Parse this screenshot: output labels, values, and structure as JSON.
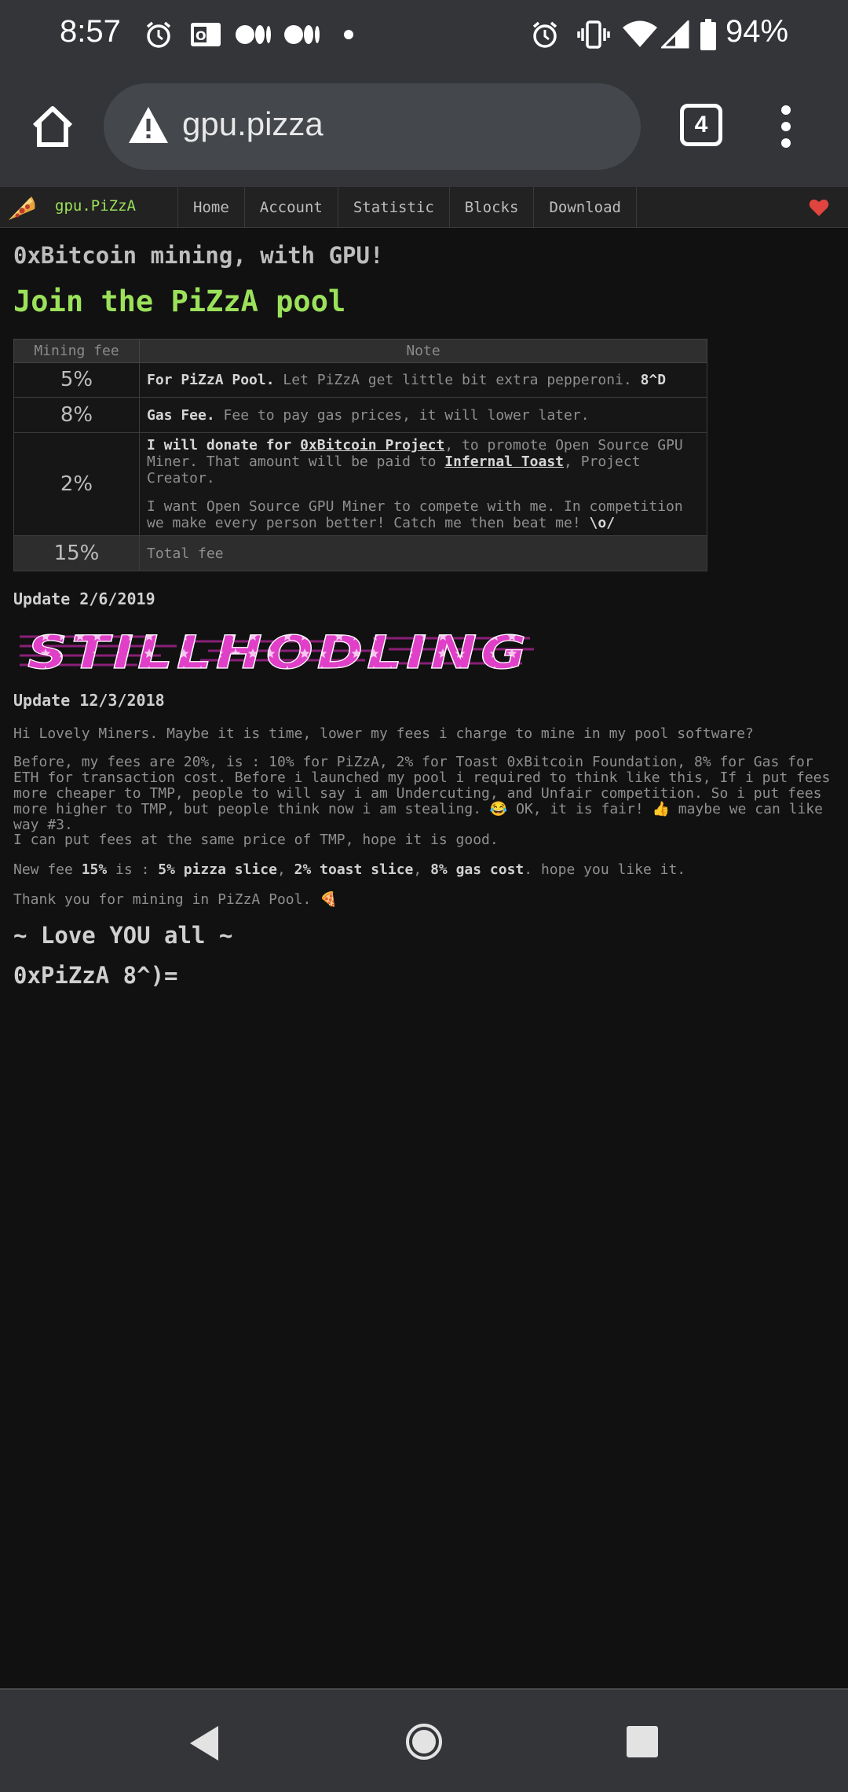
{
  "status_bar": {
    "time": "8:57",
    "battery_pct": "94%",
    "left_icons": [
      "alarm-icon",
      "email-icon",
      "medium-icon",
      "medium-icon",
      "dot-icon"
    ],
    "right_icons": [
      "alarm-icon",
      "vibrate-icon",
      "wifi-icon",
      "signal-icon",
      "battery-icon"
    ]
  },
  "browser": {
    "url": "gpu.pizza",
    "tab_count": "4"
  },
  "site_nav": {
    "brand": "gpu.PiZzA",
    "items": [
      "Home",
      "Account",
      "Statistic",
      "Blocks",
      "Download"
    ]
  },
  "page": {
    "subtitle": "0xBitcoin mining, with GPU!",
    "title": "Join the PiZzA pool",
    "table": {
      "headers": [
        "Mining fee",
        "Note"
      ],
      "rows": [
        {
          "fee": "5%",
          "note_bold": "For PiZzA Pool.",
          "note_text": " Let PiZzA get little bit extra pepperoni. ",
          "note_tail_bold": "8^D"
        },
        {
          "fee": "8%",
          "note_bold": "Gas Fee.",
          "note_text": " Fee to pay gas prices, it will lower later."
        },
        {
          "fee": "2%",
          "note_bold": "I will donate for ",
          "link1": "0xBitcoin Project",
          "note_text": ", to promote Open Source GPU Miner. That amount will be paid to ",
          "link2": "Infernal Toast",
          "note_text2": ", Project Creator.",
          "para2": "I want Open Source GPU Miner to compete with me. In competition we make every person better! Catch me then beat me! ",
          "para2_bold": "\\o/"
        }
      ],
      "total": {
        "fee": "15%",
        "note": "Total fee"
      }
    },
    "update1": "Update 2/6/2019",
    "hodl_text": "STILLHODLING",
    "update2": "Update 12/3/2018",
    "p1": "Hi Lovely Miners. Maybe it is time, lower my fees i charge to mine in my pool software?",
    "p2": "Before, my fees are 20%, is : 10% for PiZzA, 2% for Toast 0xBitcoin Foundation, 8% for Gas for ETH for transaction cost. Before i launched my pool i required to think like this, If i put fees more cheaper to TMP, people to will say i am Undercuting, and Unfair competition. So i put fees more higher to TMP, but people think now i am stealing. 😂 OK, it is fair! 👍 maybe we can like way #3.",
    "p3": "I can put fees at the same price of TMP, hope it is good.",
    "p4": {
      "a": "New fee ",
      "b": "15%",
      "c": " is : ",
      "d": "5% pizza slice",
      "e": ", ",
      "f": "2% toast slice",
      "g": ", ",
      "h": "8% gas cost",
      "i": ". hope you like it."
    },
    "p5": "Thank you for mining in PiZzA Pool. 🍕",
    "love": "~ Love YOU all ~",
    "sign": "0xPiZzA 8^)="
  },
  "colors": {
    "background": "#111111",
    "accent_green": "#9be25a",
    "chrome_bar": "#333538",
    "hodl_pink": "#e040c8"
  }
}
